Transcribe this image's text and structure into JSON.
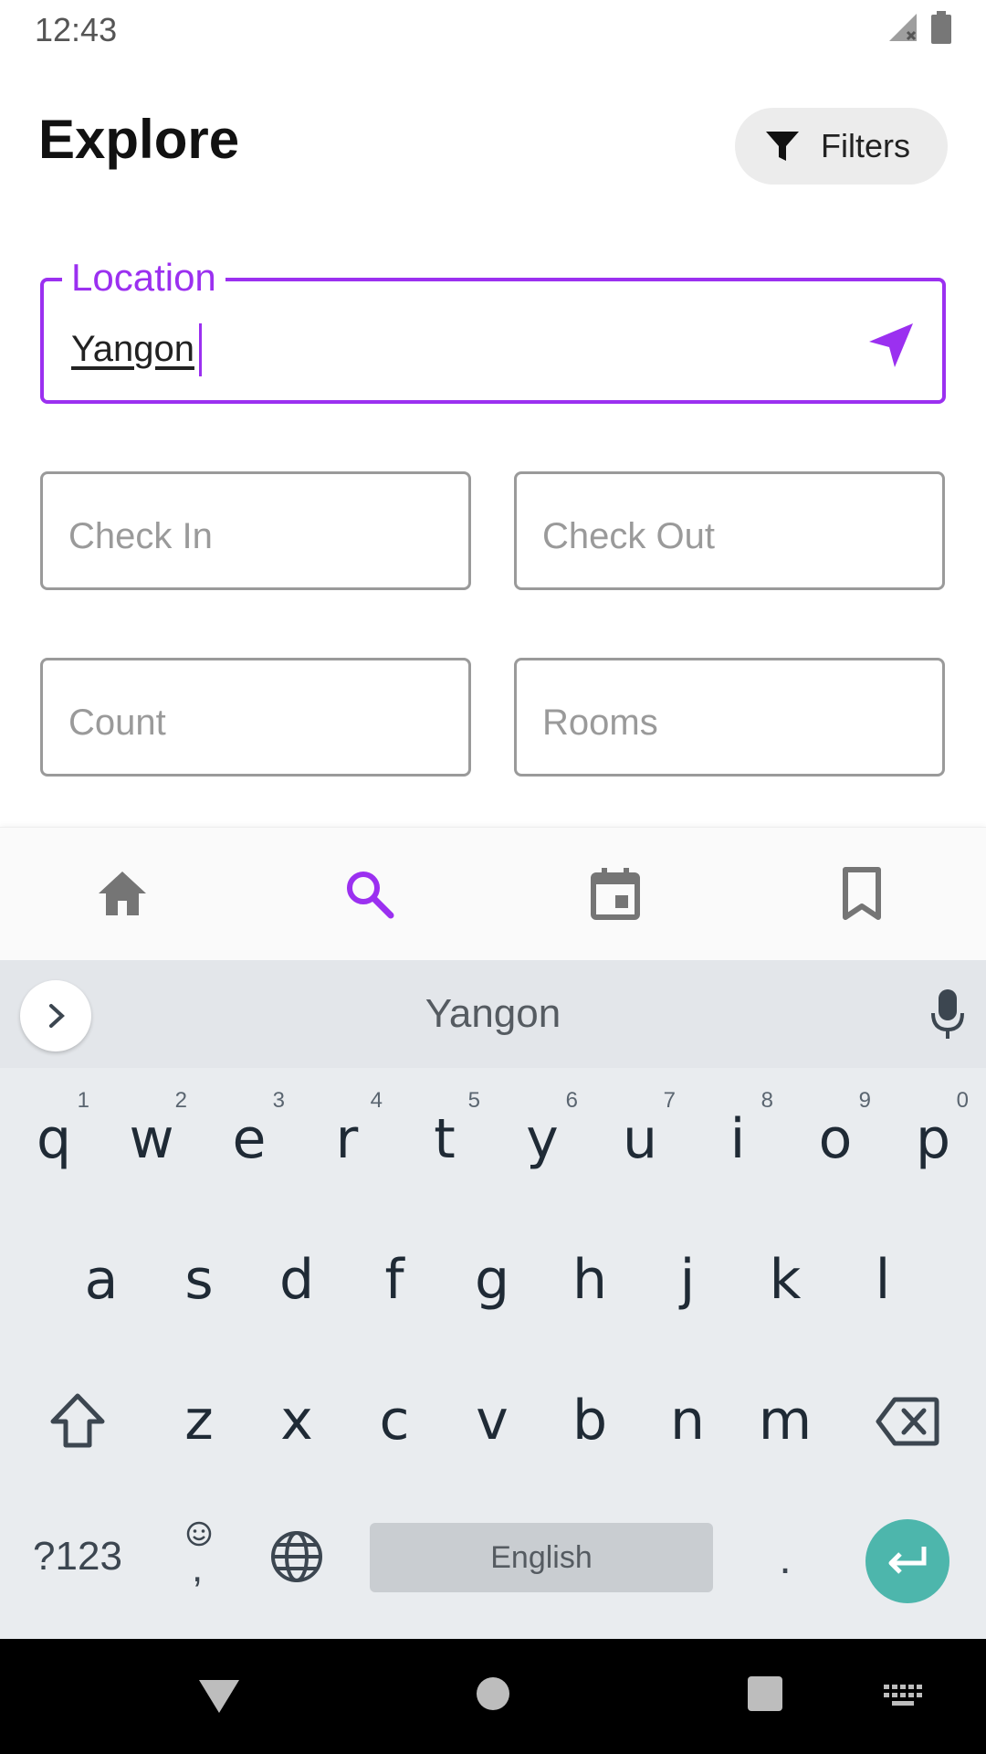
{
  "status_bar": {
    "time": "12:43",
    "icons": [
      "signal-off-icon",
      "battery-icon"
    ]
  },
  "header": {
    "title": "Explore",
    "filters_label": "Filters",
    "filters_icon": "filter-funnel-icon"
  },
  "form": {
    "location": {
      "label": "Location",
      "value": "Yangon",
      "icon": "navigation-arrow-icon"
    },
    "check_in": {
      "placeholder": "Check In"
    },
    "check_out": {
      "placeholder": "Check Out"
    },
    "count": {
      "placeholder": "Count"
    },
    "rooms": {
      "placeholder": "Rooms"
    }
  },
  "bottom_nav": {
    "items": [
      {
        "name": "home",
        "icon": "home-icon",
        "active": false
      },
      {
        "name": "search",
        "icon": "search-icon",
        "active": true
      },
      {
        "name": "calendar",
        "icon": "calendar-icon",
        "active": false
      },
      {
        "name": "bookmarks",
        "icon": "bookmark-icon",
        "active": false
      }
    ],
    "active_color": "#9b30f0",
    "inactive_color": "#757575"
  },
  "keyboard": {
    "suggestion": "Yangon",
    "row1": [
      {
        "key": "q",
        "hint": "1"
      },
      {
        "key": "w",
        "hint": "2"
      },
      {
        "key": "e",
        "hint": "3"
      },
      {
        "key": "r",
        "hint": "4"
      },
      {
        "key": "t",
        "hint": "5"
      },
      {
        "key": "y",
        "hint": "6"
      },
      {
        "key": "u",
        "hint": "7"
      },
      {
        "key": "i",
        "hint": "8"
      },
      {
        "key": "o",
        "hint": "9"
      },
      {
        "key": "p",
        "hint": "0"
      }
    ],
    "row2": [
      "a",
      "s",
      "d",
      "f",
      "g",
      "h",
      "j",
      "k",
      "l"
    ],
    "row3": [
      "z",
      "x",
      "c",
      "v",
      "b",
      "n",
      "m"
    ],
    "symbols_label": "?123",
    "emoji_comma": ",",
    "space_label": "English",
    "period": ".",
    "enter_color": "#4db6ac"
  },
  "accent_color": "#9b30f0"
}
